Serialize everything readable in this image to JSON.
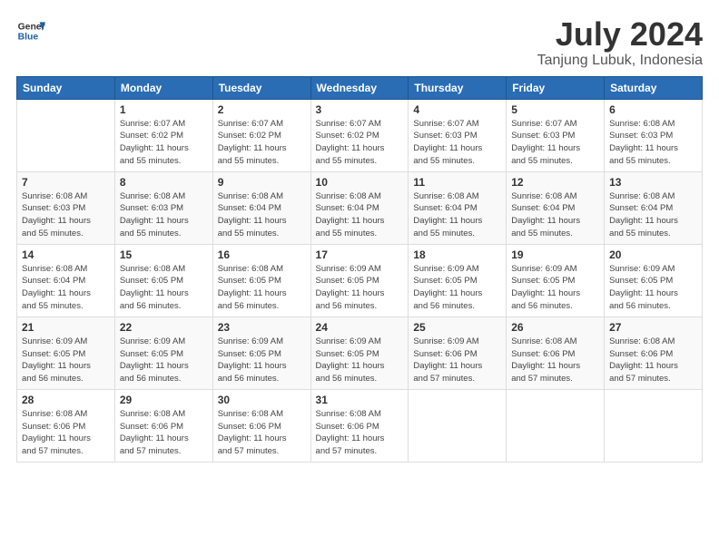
{
  "logo": {
    "line1": "General",
    "line2": "Blue"
  },
  "title": "July 2024",
  "subtitle": "Tanjung Lubuk, Indonesia",
  "weekdays": [
    "Sunday",
    "Monday",
    "Tuesday",
    "Wednesday",
    "Thursday",
    "Friday",
    "Saturday"
  ],
  "weeks": [
    [
      {
        "day": "",
        "info": ""
      },
      {
        "day": "1",
        "info": "Sunrise: 6:07 AM\nSunset: 6:02 PM\nDaylight: 11 hours\nand 55 minutes."
      },
      {
        "day": "2",
        "info": "Sunrise: 6:07 AM\nSunset: 6:02 PM\nDaylight: 11 hours\nand 55 minutes."
      },
      {
        "day": "3",
        "info": "Sunrise: 6:07 AM\nSunset: 6:02 PM\nDaylight: 11 hours\nand 55 minutes."
      },
      {
        "day": "4",
        "info": "Sunrise: 6:07 AM\nSunset: 6:03 PM\nDaylight: 11 hours\nand 55 minutes."
      },
      {
        "day": "5",
        "info": "Sunrise: 6:07 AM\nSunset: 6:03 PM\nDaylight: 11 hours\nand 55 minutes."
      },
      {
        "day": "6",
        "info": "Sunrise: 6:08 AM\nSunset: 6:03 PM\nDaylight: 11 hours\nand 55 minutes."
      }
    ],
    [
      {
        "day": "7",
        "info": "Sunrise: 6:08 AM\nSunset: 6:03 PM\nDaylight: 11 hours\nand 55 minutes."
      },
      {
        "day": "8",
        "info": "Sunrise: 6:08 AM\nSunset: 6:03 PM\nDaylight: 11 hours\nand 55 minutes."
      },
      {
        "day": "9",
        "info": "Sunrise: 6:08 AM\nSunset: 6:04 PM\nDaylight: 11 hours\nand 55 minutes."
      },
      {
        "day": "10",
        "info": "Sunrise: 6:08 AM\nSunset: 6:04 PM\nDaylight: 11 hours\nand 55 minutes."
      },
      {
        "day": "11",
        "info": "Sunrise: 6:08 AM\nSunset: 6:04 PM\nDaylight: 11 hours\nand 55 minutes."
      },
      {
        "day": "12",
        "info": "Sunrise: 6:08 AM\nSunset: 6:04 PM\nDaylight: 11 hours\nand 55 minutes."
      },
      {
        "day": "13",
        "info": "Sunrise: 6:08 AM\nSunset: 6:04 PM\nDaylight: 11 hours\nand 55 minutes."
      }
    ],
    [
      {
        "day": "14",
        "info": "Sunrise: 6:08 AM\nSunset: 6:04 PM\nDaylight: 11 hours\nand 55 minutes."
      },
      {
        "day": "15",
        "info": "Sunrise: 6:08 AM\nSunset: 6:05 PM\nDaylight: 11 hours\nand 56 minutes."
      },
      {
        "day": "16",
        "info": "Sunrise: 6:08 AM\nSunset: 6:05 PM\nDaylight: 11 hours\nand 56 minutes."
      },
      {
        "day": "17",
        "info": "Sunrise: 6:09 AM\nSunset: 6:05 PM\nDaylight: 11 hours\nand 56 minutes."
      },
      {
        "day": "18",
        "info": "Sunrise: 6:09 AM\nSunset: 6:05 PM\nDaylight: 11 hours\nand 56 minutes."
      },
      {
        "day": "19",
        "info": "Sunrise: 6:09 AM\nSunset: 6:05 PM\nDaylight: 11 hours\nand 56 minutes."
      },
      {
        "day": "20",
        "info": "Sunrise: 6:09 AM\nSunset: 6:05 PM\nDaylight: 11 hours\nand 56 minutes."
      }
    ],
    [
      {
        "day": "21",
        "info": "Sunrise: 6:09 AM\nSunset: 6:05 PM\nDaylight: 11 hours\nand 56 minutes."
      },
      {
        "day": "22",
        "info": "Sunrise: 6:09 AM\nSunset: 6:05 PM\nDaylight: 11 hours\nand 56 minutes."
      },
      {
        "day": "23",
        "info": "Sunrise: 6:09 AM\nSunset: 6:05 PM\nDaylight: 11 hours\nand 56 minutes."
      },
      {
        "day": "24",
        "info": "Sunrise: 6:09 AM\nSunset: 6:05 PM\nDaylight: 11 hours\nand 56 minutes."
      },
      {
        "day": "25",
        "info": "Sunrise: 6:09 AM\nSunset: 6:06 PM\nDaylight: 11 hours\nand 57 minutes."
      },
      {
        "day": "26",
        "info": "Sunrise: 6:08 AM\nSunset: 6:06 PM\nDaylight: 11 hours\nand 57 minutes."
      },
      {
        "day": "27",
        "info": "Sunrise: 6:08 AM\nSunset: 6:06 PM\nDaylight: 11 hours\nand 57 minutes."
      }
    ],
    [
      {
        "day": "28",
        "info": "Sunrise: 6:08 AM\nSunset: 6:06 PM\nDaylight: 11 hours\nand 57 minutes."
      },
      {
        "day": "29",
        "info": "Sunrise: 6:08 AM\nSunset: 6:06 PM\nDaylight: 11 hours\nand 57 minutes."
      },
      {
        "day": "30",
        "info": "Sunrise: 6:08 AM\nSunset: 6:06 PM\nDaylight: 11 hours\nand 57 minutes."
      },
      {
        "day": "31",
        "info": "Sunrise: 6:08 AM\nSunset: 6:06 PM\nDaylight: 11 hours\nand 57 minutes."
      },
      {
        "day": "",
        "info": ""
      },
      {
        "day": "",
        "info": ""
      },
      {
        "day": "",
        "info": ""
      }
    ]
  ]
}
